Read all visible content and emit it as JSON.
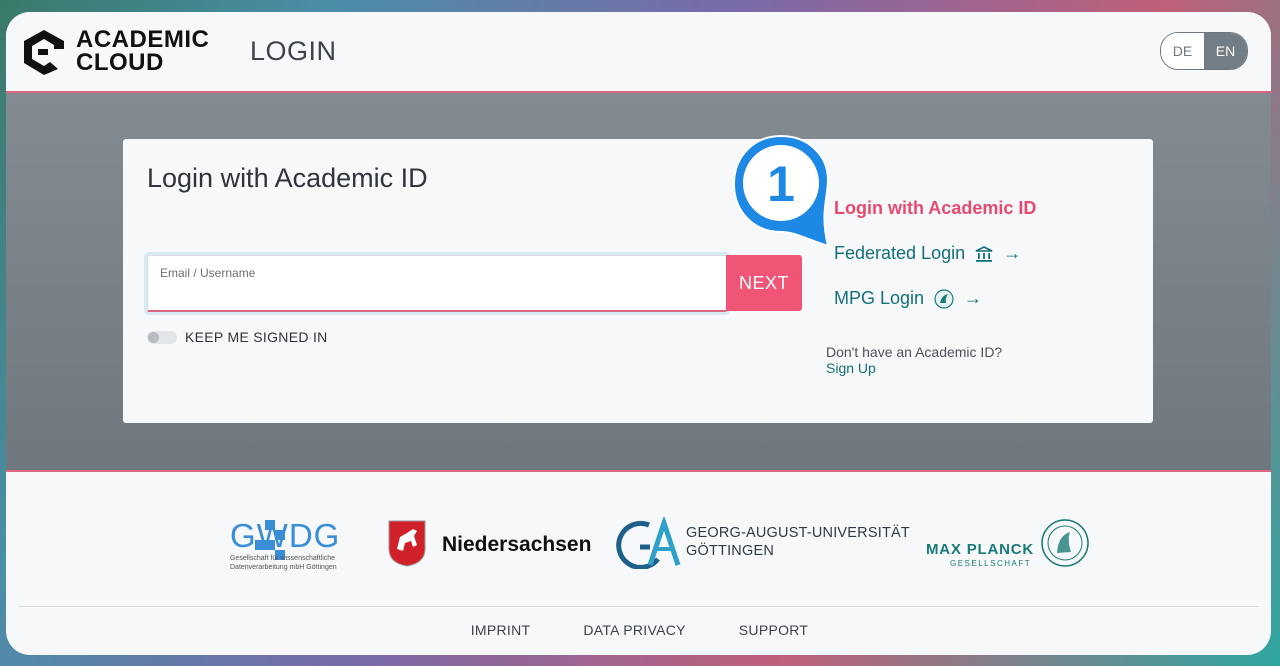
{
  "header": {
    "logo_line1": "ACADEMIC",
    "logo_line2": "CLOUD",
    "page_title": "LOGIN",
    "lang_options": [
      "DE",
      "EN"
    ],
    "lang_selected": "EN"
  },
  "card": {
    "title": "Login with Academic ID",
    "email_label": "Email / Username",
    "email_value": "",
    "next_label": "NEXT",
    "keep_signed_in_label": "KEEP ME SIGNED IN",
    "keep_signed_in": false
  },
  "options": {
    "academic": "Login with Academic ID",
    "federated": "Federated Login",
    "mpg": "MPG Login",
    "arrow": "→",
    "no_account": "Don't have an Academic ID?",
    "signup": "Sign Up"
  },
  "badge": {
    "number": "1",
    "color": "#1e88e5"
  },
  "partners": {
    "gwdg": "GWDG",
    "gwdg_sub": "Gesellschaft für wissenschaftliche Datenverarbeitung mbH Göttingen",
    "nds": "Niedersachsen",
    "ga_line1": "GEORG-AUGUST-UNIVERSITÄT",
    "ga_line2": "GÖTTINGEN",
    "mpg": "MAX PLANCK",
    "mpg_sub": "GESELLSCHAFT"
  },
  "footer": {
    "links": [
      "IMPRINT",
      "DATA PRIVACY",
      "SUPPORT"
    ]
  },
  "colors": {
    "accent": "#f15575",
    "teal": "#15707a",
    "border": "#e0667f"
  }
}
